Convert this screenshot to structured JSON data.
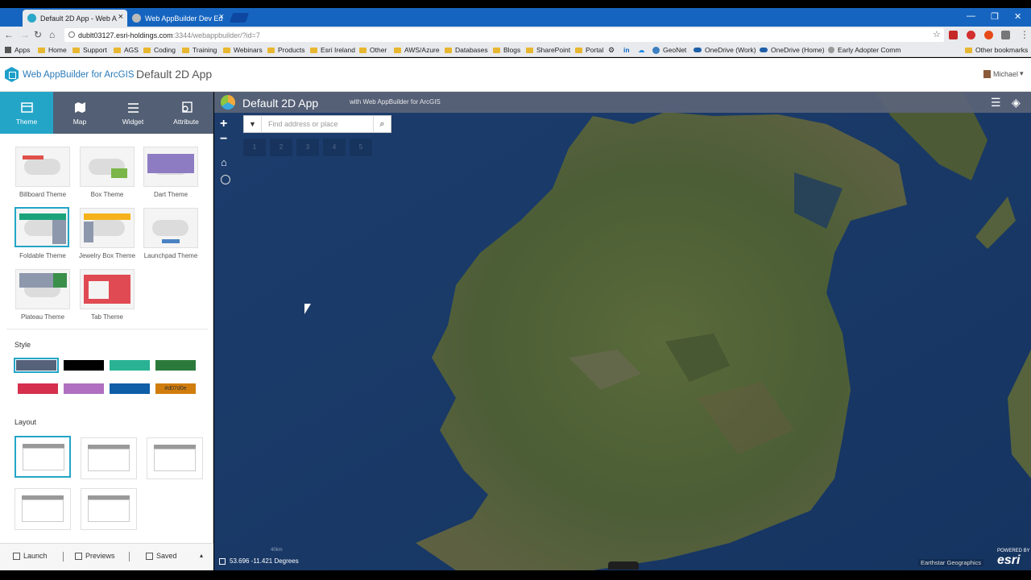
{
  "browser": {
    "tabs": [
      {
        "label": "Default 2D App - Web A",
        "active": true
      },
      {
        "label": "Web AppBuilder Dev Ed",
        "active": false
      }
    ],
    "url_host": "dublt03127.esri-holdings.com",
    "url_path": ":3344/webappbuilder/?id=7",
    "bookmarks": [
      "Apps",
      "Home",
      "Support",
      "AGS",
      "Coding",
      "Training",
      "Webinars",
      "Products",
      "Esri Ireland",
      "Other",
      "AWS/Azure",
      "Databases",
      "Blogs",
      "SharePoint",
      "Portal",
      "GeoNet",
      "OneDrive (Work)",
      "OneDrive (Home)",
      "Early Adopter Comm",
      "Other bookmarks"
    ]
  },
  "app_header": {
    "brand": "Web AppBuilder for ArcGIS",
    "title": "Default 2D App",
    "user": "Michael"
  },
  "panel_nav": [
    {
      "label": "Theme",
      "icon": "theme-icon"
    },
    {
      "label": "Map",
      "icon": "map-icon"
    },
    {
      "label": "Widget",
      "icon": "widget-list-icon"
    },
    {
      "label": "Attribute",
      "icon": "attribute-icon"
    }
  ],
  "themes": [
    {
      "label": "Billboard Theme",
      "accent": "#e0504a"
    },
    {
      "label": "Box Theme",
      "accent": "#7ab648"
    },
    {
      "label": "Dart Theme",
      "accent": "#8e7cc3"
    },
    {
      "label": "Foldable Theme",
      "accent": "#1aa37a"
    },
    {
      "label": "Jewelry Box Theme",
      "accent": "#f5b21c"
    },
    {
      "label": "Launchpad Theme",
      "accent": "#4a82c3"
    },
    {
      "label": "Plateau Theme",
      "accent": "#3a8f4a"
    },
    {
      "label": "Tab Theme",
      "accent": "#e04a52"
    }
  ],
  "style": {
    "heading": "Style",
    "swatches": [
      {
        "color": "#56627a",
        "label": ""
      },
      {
        "color": "#000000",
        "label": ""
      },
      {
        "color": "#29b394",
        "label": ""
      },
      {
        "color": "#2b7a3c",
        "label": ""
      },
      {
        "color": "#d5304d",
        "label": ""
      },
      {
        "color": "#b06fc0",
        "label": ""
      },
      {
        "color": "#0e5ea8",
        "label": ""
      },
      {
        "color": "#d07d0e",
        "label": "#d07d0e"
      }
    ]
  },
  "layout": {
    "heading": "Layout"
  },
  "footer": {
    "launch": "Launch",
    "previews": "Previews",
    "saved": "Saved"
  },
  "map": {
    "title": "Default 2D App",
    "subtitle": "with Web AppBuilder for ArcGIS",
    "search_placeholder": "Find address or place",
    "slots": [
      "1",
      "2",
      "3",
      "4",
      "5"
    ],
    "coords": "53.696 -11.421 Degrees",
    "scale": "40km",
    "attribution": "Earthstar Geographics",
    "powered_by": "POWERED BY",
    "esri": "esri"
  }
}
